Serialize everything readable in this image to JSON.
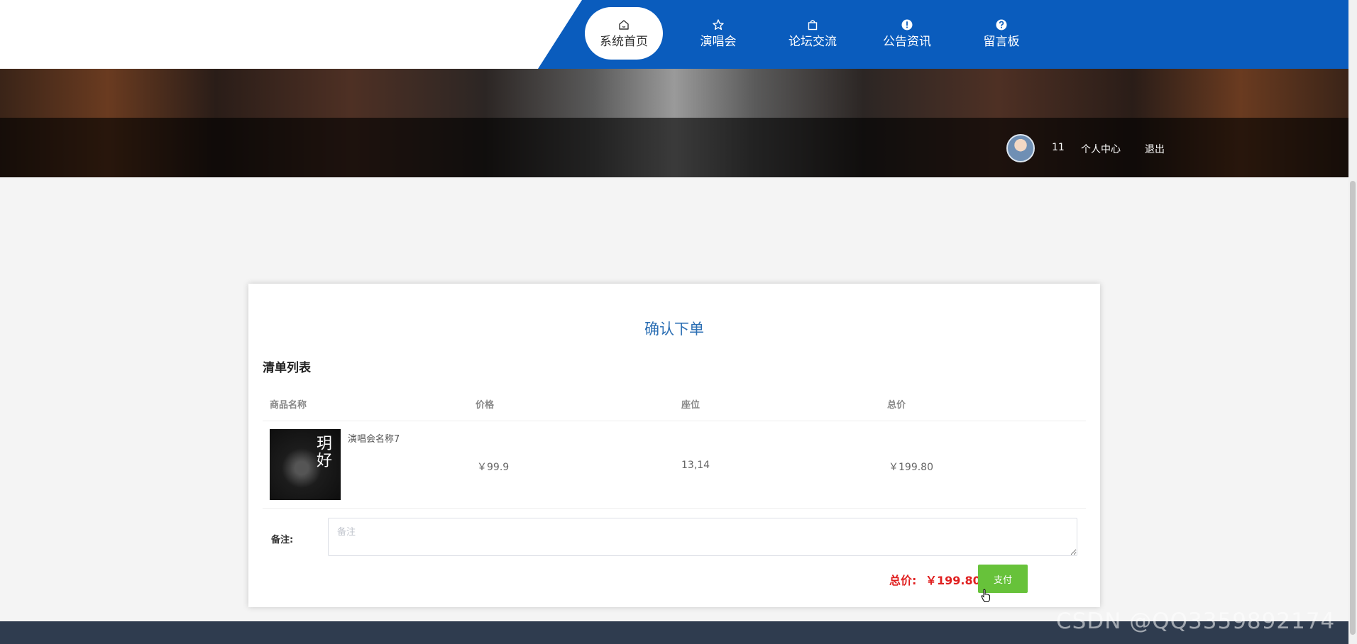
{
  "nav": {
    "items": [
      {
        "label": "系统首页",
        "icon": "home-icon",
        "active": true
      },
      {
        "label": "演唱会",
        "icon": "star-icon",
        "active": false
      },
      {
        "label": "论坛交流",
        "icon": "bag-icon",
        "active": false
      },
      {
        "label": "公告资讯",
        "icon": "exclamation-icon",
        "active": false
      },
      {
        "label": "留言板",
        "icon": "question-icon",
        "active": false
      }
    ]
  },
  "user": {
    "name": "11",
    "center_label": "个人中心",
    "logout_label": "退出"
  },
  "order": {
    "title": "确认下单",
    "section_title": "清单列表",
    "columns": [
      "商品名称",
      "价格",
      "座位",
      "总价"
    ],
    "row": {
      "thumb_text": "玥好",
      "name": "演唱会名称7",
      "price": "￥99.9",
      "seat": "13,14",
      "total": "￥199.80"
    },
    "note_label": "备注:",
    "note_placeholder": "备注",
    "total_label": "总价:",
    "total_value": "￥199.80",
    "pay_label": "支付"
  },
  "watermark": "CSDN @QQ3359892174",
  "colors": {
    "nav_blue": "#0a5cbd",
    "title_blue": "#2c6fb4",
    "price_red": "#e02020",
    "pay_green": "#67c23a",
    "footer": "#2f3c4f"
  }
}
